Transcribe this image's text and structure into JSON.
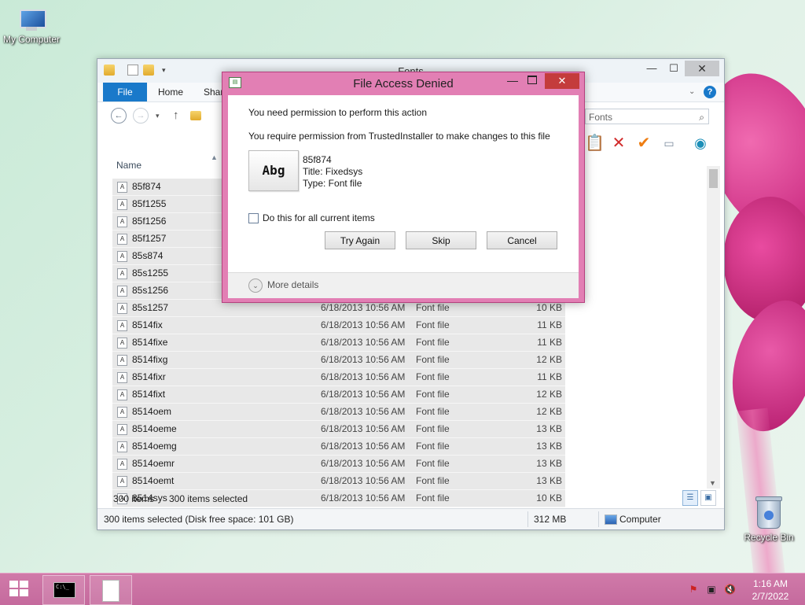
{
  "desktop": {
    "icons": [
      {
        "label": "My Computer"
      },
      {
        "label": "Recycle Bin"
      }
    ]
  },
  "explorer": {
    "title": "Fonts",
    "ribbon_tabs": [
      "File",
      "Home",
      "Shar"
    ],
    "address_fragment": "",
    "search_placeholder": "Fonts",
    "column_header": "Name",
    "rows": [
      {
        "name": "85f874",
        "date": "",
        "type": "",
        "size": ""
      },
      {
        "name": "85f1255",
        "date": "",
        "type": "",
        "size": ""
      },
      {
        "name": "85f1256",
        "date": "",
        "type": "",
        "size": ""
      },
      {
        "name": "85f1257",
        "date": "",
        "type": "",
        "size": ""
      },
      {
        "name": "85s874",
        "date": "",
        "type": "",
        "size": ""
      },
      {
        "name": "85s1255",
        "date": "",
        "type": "",
        "size": ""
      },
      {
        "name": "85s1256",
        "date": "",
        "type": "",
        "size": ""
      },
      {
        "name": "85s1257",
        "date": "6/18/2013 10:56 AM",
        "type": "Font file",
        "size": "10 KB"
      },
      {
        "name": "8514fix",
        "date": "6/18/2013 10:56 AM",
        "type": "Font file",
        "size": "11 KB"
      },
      {
        "name": "8514fixe",
        "date": "6/18/2013 10:56 AM",
        "type": "Font file",
        "size": "11 KB"
      },
      {
        "name": "8514fixg",
        "date": "6/18/2013 10:56 AM",
        "type": "Font file",
        "size": "12 KB"
      },
      {
        "name": "8514fixr",
        "date": "6/18/2013 10:56 AM",
        "type": "Font file",
        "size": "11 KB"
      },
      {
        "name": "8514fixt",
        "date": "6/18/2013 10:56 AM",
        "type": "Font file",
        "size": "12 KB"
      },
      {
        "name": "8514oem",
        "date": "6/18/2013 10:56 AM",
        "type": "Font file",
        "size": "12 KB"
      },
      {
        "name": "8514oeme",
        "date": "6/18/2013 10:56 AM",
        "type": "Font file",
        "size": "13 KB"
      },
      {
        "name": "8514oemg",
        "date": "6/18/2013 10:56 AM",
        "type": "Font file",
        "size": "13 KB"
      },
      {
        "name": "8514oemr",
        "date": "6/18/2013 10:56 AM",
        "type": "Font file",
        "size": "13 KB"
      },
      {
        "name": "8514oemt",
        "date": "6/18/2013 10:56 AM",
        "type": "Font file",
        "size": "13 KB"
      },
      {
        "name": "8514sys",
        "date": "6/18/2013 10:56 AM",
        "type": "Font file",
        "size": "10 KB"
      }
    ],
    "status_count": "300 items",
    "status_selected": "300 items selected",
    "status_bar_text": "300 items selected (Disk free space: 101 GB)",
    "status_size": "312 MB",
    "status_location": "Computer"
  },
  "dialog": {
    "title": "File Access Denied",
    "heading": "You need permission to perform this action",
    "message": "You require permission from TrustedInstaller to make changes to this file",
    "file_name": "85f874",
    "file_title": "Title: Fixedsys",
    "file_type": "Type: Font file",
    "thumb_text": "Abg",
    "checkbox_label": "Do this for all current items",
    "buttons": {
      "try_again": "Try Again",
      "skip": "Skip",
      "cancel": "Cancel"
    },
    "more_details": "More details"
  },
  "taskbar": {
    "time": "1:16 AM",
    "date": "2/7/2022"
  },
  "colors": {
    "accent": "#1979ca",
    "dialog_frame": "#e27fb4",
    "taskbar": "#c56a9d",
    "close_red": "#c43c3c"
  }
}
